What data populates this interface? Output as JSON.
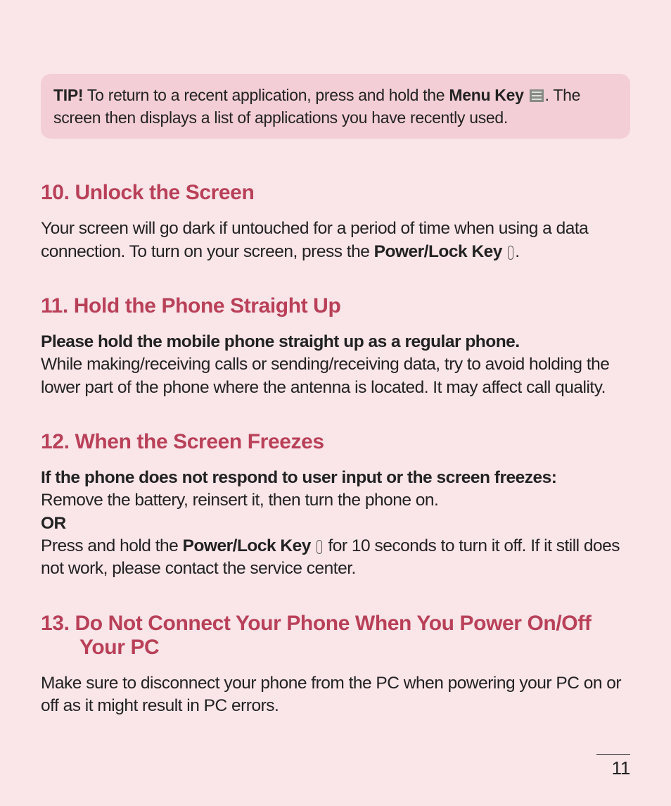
{
  "tip": {
    "label": "TIP!",
    "text_before": " To return to a recent application, press and hold the ",
    "menu_key_bold": "Menu Key",
    "text_after": ". The screen then displays a list of applications you have recently used."
  },
  "section10": {
    "heading": "10. Unlock the Screen",
    "text_before": "Your screen will go dark if untouched for a period of time when using a data connection. To turn on your screen, press the ",
    "power_key_bold": "Power/Lock Key",
    "text_after": "."
  },
  "section11": {
    "heading": "11. Hold the Phone Straight Up",
    "bold_line": "Please hold the mobile phone straight up as a regular phone.",
    "text": "While making/receiving calls or sending/receiving data, try to avoid holding the lower part of the phone where the antenna is located. It may affect call quality."
  },
  "section12": {
    "heading": "12. When the Screen Freezes",
    "bold_line": "If the phone does not respond to user input or the screen freezes:",
    "line1": "Remove the battery, reinsert it, then turn the phone on.",
    "or_label": "OR",
    "line2_before": "Press and hold the ",
    "power_key_bold": "Power/Lock Key",
    "line2_after": " for 10 seconds to turn it off. If it still does not work, please contact the service center."
  },
  "section13": {
    "heading": "13. Do Not Connect Your Phone When You Power On/Off Your PC",
    "text": "Make sure to disconnect your phone from the PC when powering your PC on or off as it might result in PC errors."
  },
  "page_number": "11"
}
